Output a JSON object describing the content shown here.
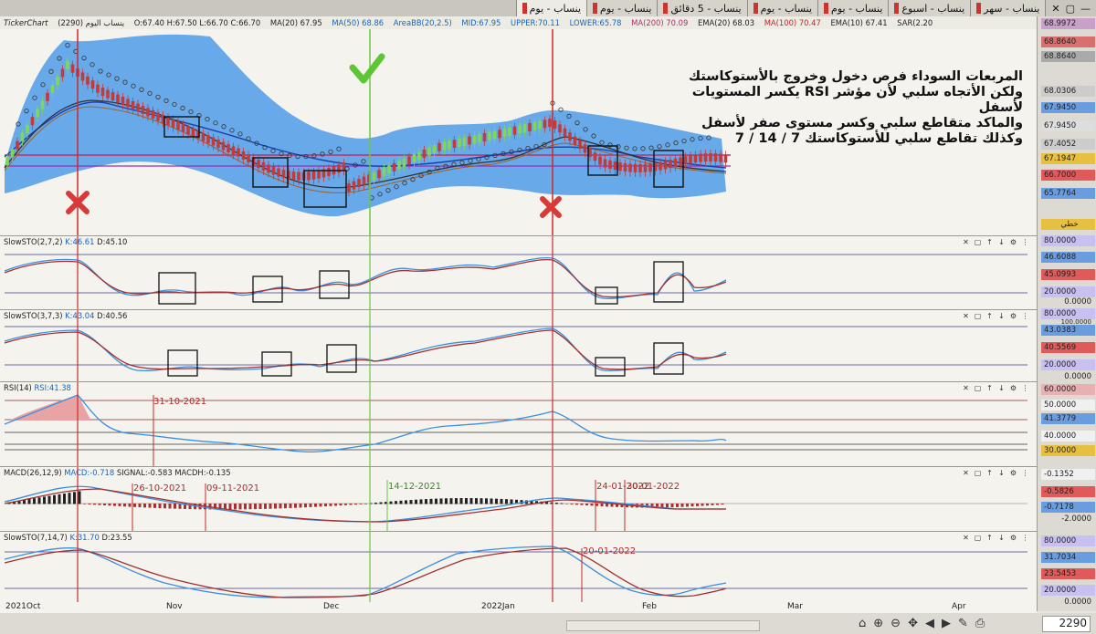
{
  "tabs": [
    {
      "label": "ينساب - سهر"
    },
    {
      "label": "ينساب - اسبوع"
    },
    {
      "label": "ينساب - يوم"
    },
    {
      "label": "ينساب - يوم"
    },
    {
      "label": "ينساب - 5 دقائق"
    },
    {
      "label": "ينساب - يوم"
    },
    {
      "label": "ينساب - يوم"
    }
  ],
  "window_controls": {
    "minimize": "—",
    "maximize": "▢",
    "close": "✕"
  },
  "infobar": {
    "source": "TickerChart",
    "symbol": "ينساب اليوم (2290)",
    "ohlc": "O:67.40 H:67.50 L:66.70 C:66.70",
    "ma20": "MA(20) 67.95",
    "ma50": "MA(50) 68.86",
    "areabb": "AreaBB(20,2.5)",
    "mid": "MID:67.95",
    "upper": "UPPER:70.11",
    "lower": "LOWER:65.78",
    "ma200": "MA(200) 70.09",
    "ema20": "EMA(20) 68.03",
    "ma100": "MA(100) 70.47",
    "ema10": "EMA(10) 67.41",
    "sar": "SAR(2.20"
  },
  "annotation_lines": [
    "المربعات السوداء فرص دخول وخروج بالأستوكاستك",
    "ولكن الأتجاه سلبي لأن مؤشر  RSI يكسر المستويات لأسفل",
    "والماكد متقاطع سلبي وكسر مستوى صفر لأسفل",
    "وكذلك تقاطع سلبي للأستوكاستك 7 / 14 / 7"
  ],
  "price_axis": [
    "68.9972",
    "68.8640",
    "68.8640",
    "68.0306",
    "67.9450",
    "67.9450",
    "67.4052",
    "67.1947",
    "66.7000",
    "65.7764"
  ],
  "price_axis_button": "خطي",
  "panels": {
    "sto1": {
      "title": "SlowSTO(2,7,2)",
      "k": "K:46.61",
      "d": "D:45.10",
      "axis": [
        "80.0000",
        "46.6088",
        "45.0993",
        "20.0000",
        "0.0000"
      ]
    },
    "sto2": {
      "title": "SlowSTO(3,7,3)",
      "k": "K:43.04",
      "d": "D:40.56",
      "axis": [
        "80.0000",
        "100.0000",
        "43.0383",
        "40.5569",
        "20.0000",
        "0.0000"
      ]
    },
    "rsi": {
      "title": "RSI(14)",
      "value": "RSI:41.38",
      "axis": [
        "60.0000",
        "50.0000",
        "41.3779",
        "40.0000",
        "30.0000"
      ],
      "date": "31-10-2021"
    },
    "macd": {
      "title": "MACD(26,12,9)",
      "macd": "MACD:-0.718",
      "signal": "SIGNAL:-0.583",
      "hist": "MACDH:-0.135",
      "axis": [
        "-0.1352",
        "-0.5826",
        "-0.7178",
        "-2.0000"
      ],
      "dates": [
        "26-10-2021",
        "09-11-2021",
        "14-12-2021",
        "24-01-2022",
        "30-01-2022"
      ]
    },
    "sto3": {
      "title": "SlowSTO(7,14,7)",
      "k": "K:31.70",
      "d": "D:23.55",
      "axis": [
        "80.0000",
        "31.7034",
        "23.5453",
        "20.0000",
        "0.0000"
      ],
      "date": "20-01-2022"
    }
  },
  "xaxis": [
    "2021Oct",
    "Nov",
    "Dec",
    "2022Jan",
    "Feb",
    "Mar",
    "Apr"
  ],
  "bottom": {
    "symbol_code": "2290"
  },
  "colors": {
    "bb_fill": "#4d9be8",
    "up_candle": "#7ed957",
    "down_candle": "#c43a3a",
    "buy_line": "#6cc644",
    "sell_line": "#cc2a2a",
    "stoch_k": "#3a8fe0",
    "stoch_d": "#a23030"
  }
}
